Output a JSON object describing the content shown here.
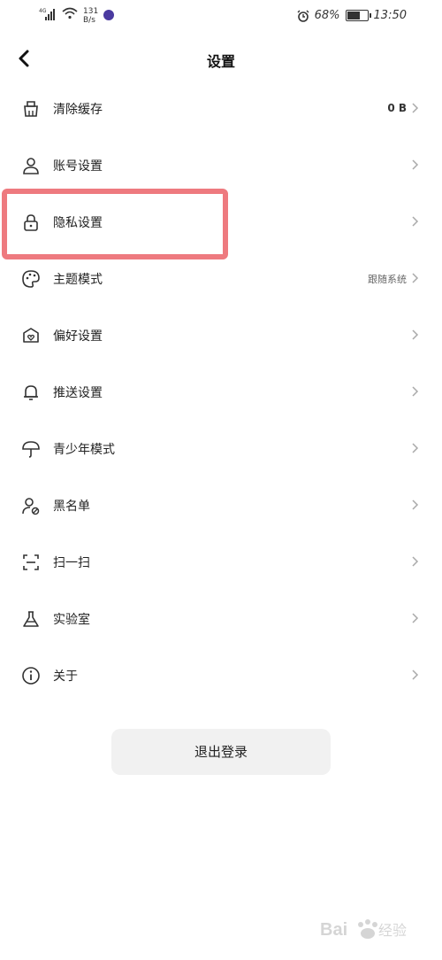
{
  "status_bar": {
    "signal_label": "4G",
    "net_speed_value": "131",
    "net_speed_unit": "B/s",
    "battery": "68%",
    "time": "13:50",
    "battery_level_pct": 68
  },
  "header": {
    "title": "设置"
  },
  "items": [
    {
      "label": "清除缓存",
      "value": "0 B",
      "icon": "broom-icon"
    },
    {
      "label": "账号设置",
      "value": "",
      "icon": "user-icon"
    },
    {
      "label": "隐私设置",
      "value": "",
      "icon": "lock-icon"
    },
    {
      "label": "主题模式",
      "value": "跟随系统",
      "icon": "palette-icon"
    },
    {
      "label": "偏好设置",
      "value": "",
      "icon": "heart-tag-icon"
    },
    {
      "label": "推送设置",
      "value": "",
      "icon": "bell-icon"
    },
    {
      "label": "青少年模式",
      "value": "",
      "icon": "umbrella-icon"
    },
    {
      "label": "黑名单",
      "value": "",
      "icon": "user-block-icon"
    },
    {
      "label": "扫一扫",
      "value": "",
      "icon": "scan-icon"
    },
    {
      "label": "实验室",
      "value": "",
      "icon": "flask-icon"
    },
    {
      "label": "关于",
      "value": "",
      "icon": "info-icon"
    }
  ],
  "logout_label": "退出登录",
  "colors": {
    "highlight": "#ee7a7f",
    "logout_bg": "#f1f1f1"
  }
}
